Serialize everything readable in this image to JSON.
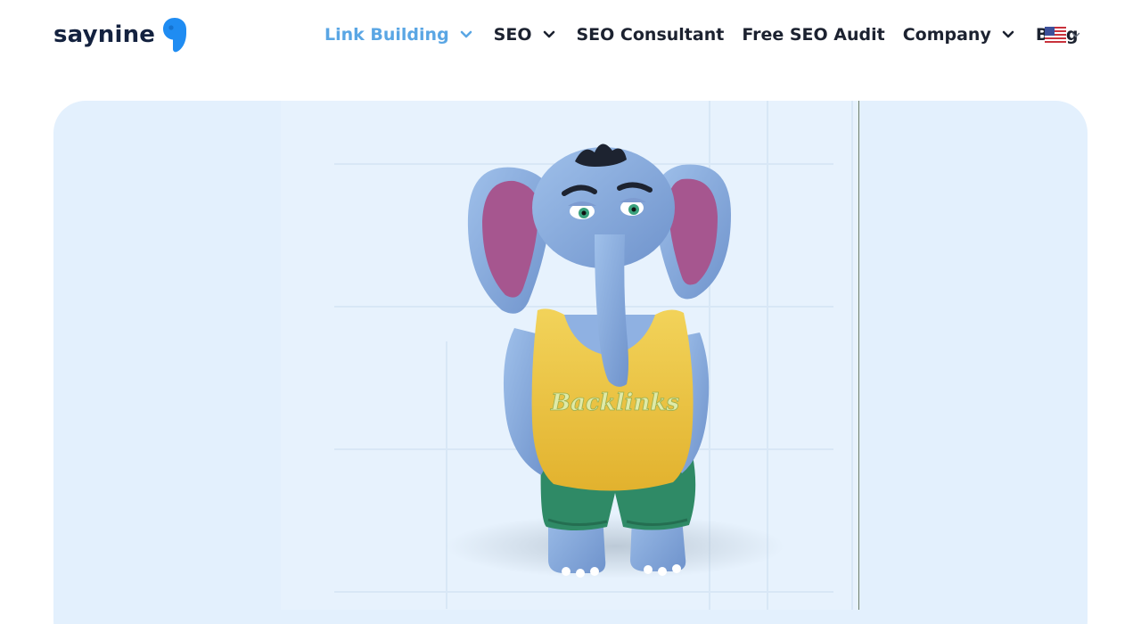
{
  "header": {
    "logo_text": "saynine",
    "nav": [
      {
        "label": "Link Building",
        "has_dropdown": true,
        "active": true
      },
      {
        "label": "SEO",
        "has_dropdown": true,
        "active": false
      },
      {
        "label": "SEO Consultant",
        "has_dropdown": false,
        "active": false
      },
      {
        "label": "Free SEO Audit",
        "has_dropdown": false,
        "active": false
      },
      {
        "label": "Company",
        "has_dropdown": true,
        "active": false
      },
      {
        "label": "Blog",
        "has_dropdown": false,
        "active": false
      }
    ],
    "language_icon": "us-flag-icon"
  },
  "hero": {
    "mascot_shirt_text": "Backlinks"
  },
  "colors": {
    "brand_dark": "#14223f",
    "brand_blue": "#1f8cf2",
    "nav_active": "#5aa6e4",
    "hero_bg": "#e3f0fd"
  }
}
